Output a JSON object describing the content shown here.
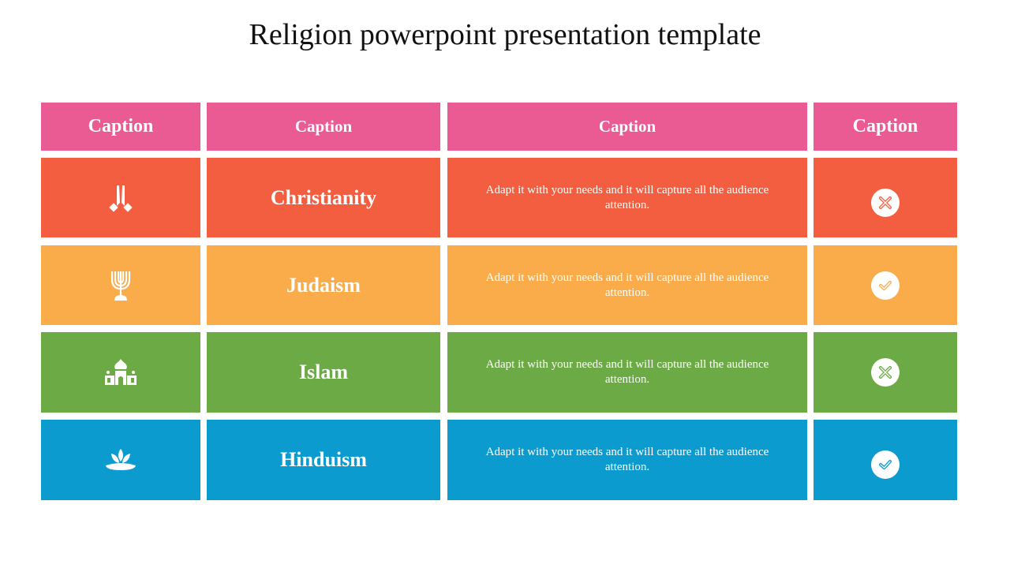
{
  "title": "Religion powerpoint presentation template",
  "colors": {
    "header": "#EA5A93",
    "christianity": "#F25E3F",
    "judaism": "#FAAC4A",
    "islam": "#6BAA44",
    "hinduism": "#0B9BCF"
  },
  "headers": [
    "Caption",
    "Caption",
    "Caption",
    "Caption"
  ],
  "rows": [
    {
      "icon": "praying-hands-icon",
      "name": "Christianity",
      "description": "Adapt it with your needs and it will capture all the audience attention.",
      "status": "cross"
    },
    {
      "icon": "menorah-icon",
      "name": "Judaism",
      "description": "Adapt it with your needs and it will capture all the audience attention.",
      "status": "check"
    },
    {
      "icon": "mosque-icon",
      "name": "Islam",
      "description": "Adapt it with your needs and it will capture all the audience attention.",
      "status": "cross"
    },
    {
      "icon": "lotus-icon",
      "name": "Hinduism",
      "description": "Adapt it with your needs and it will capture all the audience attention.",
      "status": "check"
    }
  ]
}
